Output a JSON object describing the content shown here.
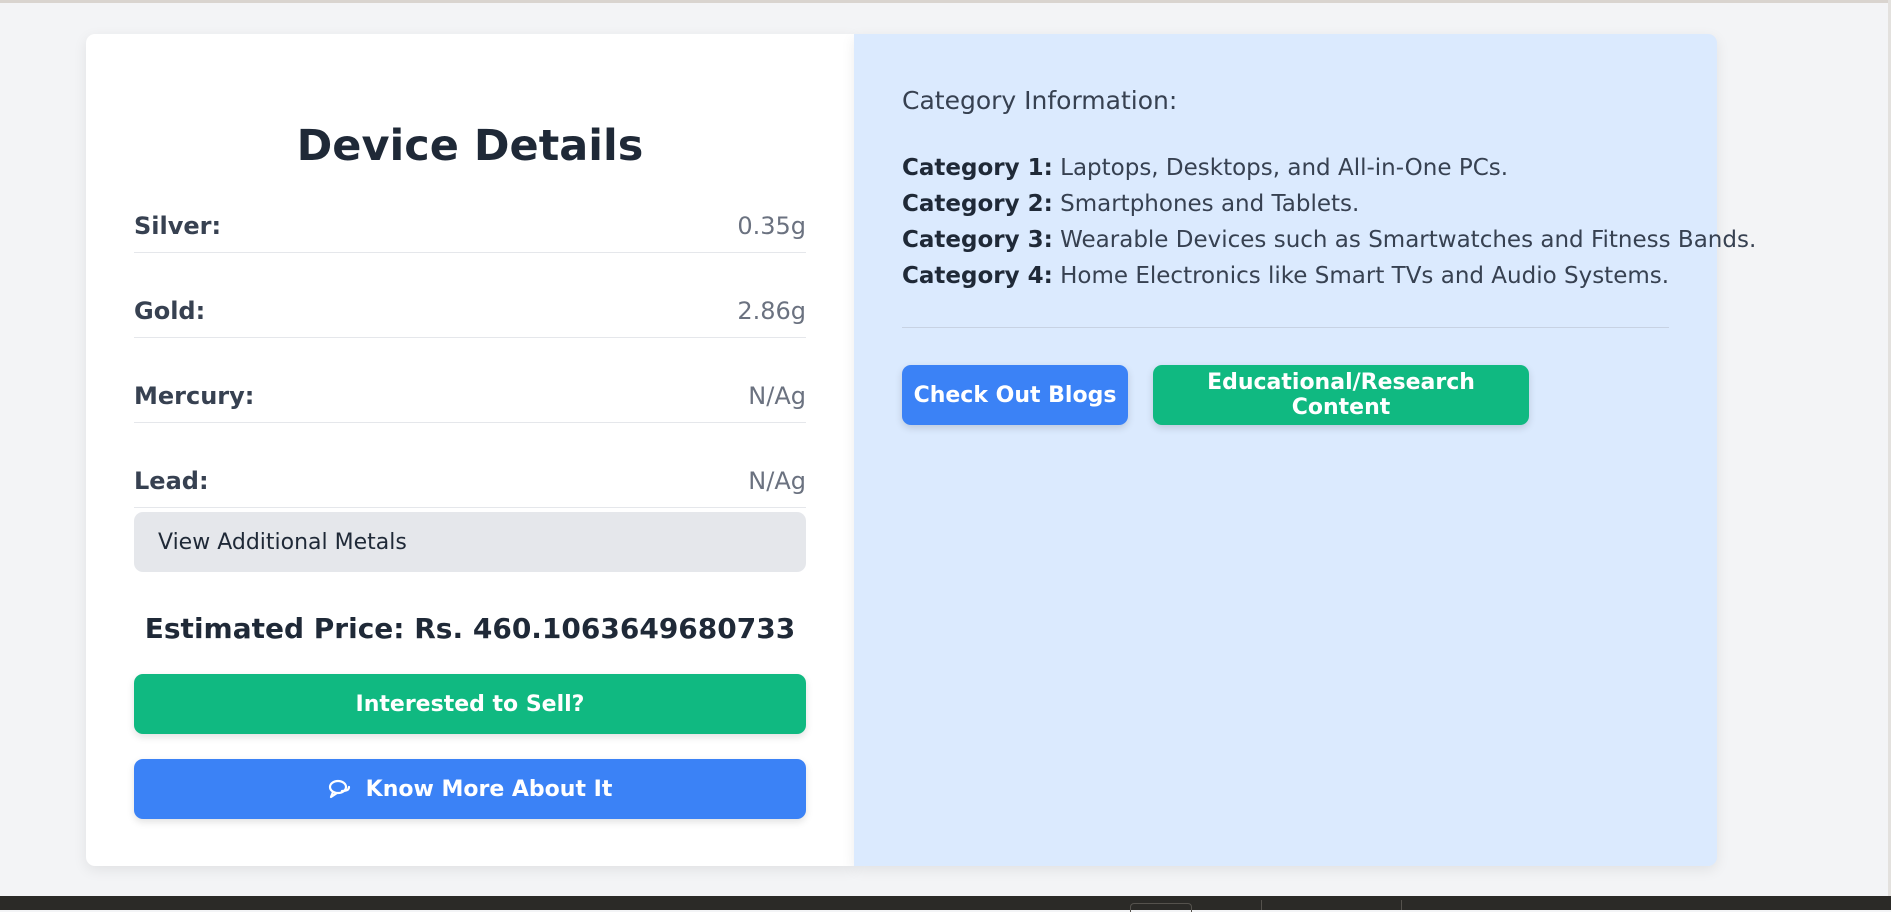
{
  "device": {
    "title": "Device Details",
    "metals": [
      {
        "label": "Silver:",
        "value": "0.35g"
      },
      {
        "label": "Gold:",
        "value": "2.86g"
      },
      {
        "label": "Mercury:",
        "value": "N/Ag"
      },
      {
        "label": "Lead:",
        "value": "N/Ag"
      }
    ],
    "view_metals_label": "View Additional Metals",
    "price_text": "Estimated Price: Rs. 460.1063649680733",
    "sell_label": "Interested to Sell?",
    "know_more_label": "Know More About It",
    "know_more_icon": "chat-bubbles-icon"
  },
  "categories": {
    "heading": "Category Information:",
    "items": [
      {
        "name": "Category 1:",
        "desc": "Laptops, Desktops, and All-in-One PCs."
      },
      {
        "name": "Category 2:",
        "desc": "Smartphones and Tablets."
      },
      {
        "name": "Category 3:",
        "desc": "Wearable Devices such as Smartwatches and Fitness Bands."
      },
      {
        "name": "Category 4:",
        "desc": "Home Electronics like Smart TVs and Audio Systems."
      }
    ],
    "blogs_label": "Check Out Blogs",
    "edu_label": "Educational/Research Content"
  },
  "colors": {
    "page_bg": "#f3f4f6",
    "panel_blue": "#dbeafe",
    "green": "#10b981",
    "blue": "#3b82f6",
    "gray_button": "#e5e7eb"
  }
}
